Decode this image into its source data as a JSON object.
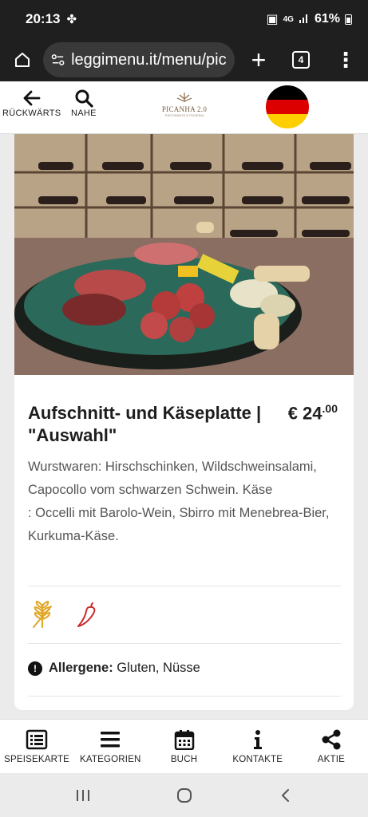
{
  "status": {
    "time": "20:13",
    "network": "4G",
    "battery": "61%"
  },
  "browser": {
    "url": "leggimenu.it/menu/pica",
    "tab_count": "4"
  },
  "header": {
    "back_label": "RÜCKWÄRTS",
    "near_label": "NAHE",
    "logo_text": "PICANHA 2.0",
    "logo_sub": "RISTORANTE E PIZZERIA"
  },
  "item": {
    "title": "Aufschnitt- und Käseplatte | \"Auswahl\"",
    "price_main": "€ 24",
    "price_cents": ".00",
    "description_1": "Wurstwaren: Hirschschinken, Wildschweinsalami, Capocollo vom schwarzen Schwein. Käse",
    "description_2": ": Occelli mit Barolo-Wein, Sbirro mit Menebrea-Bier, Kurkuma-Käse.",
    "allergens_label": "Allergene:",
    "allergens_value": " Gluten, Nüsse"
  },
  "nav": {
    "menu": "SPEISEKARTE",
    "categories": "KATEGORIEN",
    "book": "BUCH",
    "contacts": "KONTAKTE",
    "share": "AKTIE"
  },
  "colors": {
    "flag_black": "#000000",
    "flag_red": "#dd0000",
    "flag_gold": "#ffce00",
    "wheat": "#e0a626",
    "chili": "#cc2a2a"
  }
}
